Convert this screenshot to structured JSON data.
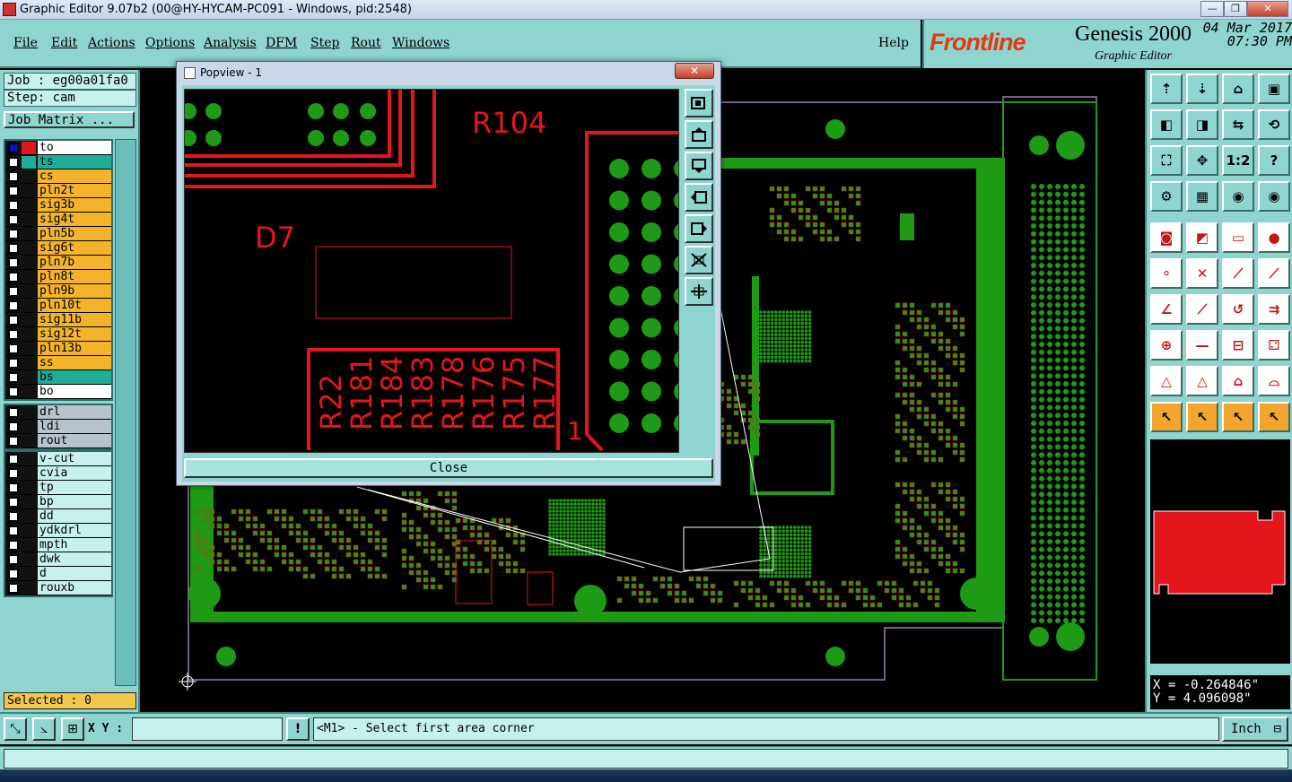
{
  "window": {
    "title": "Graphic Editor 9.07b2 (00@HY-HYCAM-PC091 - Windows, pid:2548)",
    "min": "—",
    "max": "❐",
    "close": "✕"
  },
  "menu": [
    "File",
    "Edit",
    "Actions",
    "Options",
    "Analysis",
    "DFM",
    "Step",
    "Rout",
    "Windows"
  ],
  "help": "Help",
  "brand": {
    "logo": "Frontline",
    "product": "Genesis 2000",
    "subtitle": "Graphic Editor",
    "date": "04 Mar 2017",
    "time": "07:30 PM"
  },
  "job": "Job : eg00a01fa0",
  "step": "Step: cam",
  "job_matrix": "Job Matrix ...",
  "layers_board": [
    {
      "name": "to",
      "color": "#ffffff"
    },
    {
      "name": "ts",
      "color": "#1eae98"
    },
    {
      "name": "cs",
      "color": "#f3b42c"
    },
    {
      "name": "pln2t",
      "color": "#f3b42c"
    },
    {
      "name": "sig3b",
      "color": "#f3b42c"
    },
    {
      "name": "sig4t",
      "color": "#f3b42c"
    },
    {
      "name": "pln5b",
      "color": "#f3b42c"
    },
    {
      "name": "sig6t",
      "color": "#f3b42c"
    },
    {
      "name": "pln7b",
      "color": "#f3b42c"
    },
    {
      "name": "pln8t",
      "color": "#f3b42c"
    },
    {
      "name": "pln9b",
      "color": "#f3b42c"
    },
    {
      "name": "pln10t",
      "color": "#f3b42c"
    },
    {
      "name": "sig11b",
      "color": "#f3b42c"
    },
    {
      "name": "sig12t",
      "color": "#f3b42c"
    },
    {
      "name": "pln13b",
      "color": "#f3b42c"
    },
    {
      "name": "ss",
      "color": "#f3b42c"
    },
    {
      "name": "bs",
      "color": "#1eae98"
    },
    {
      "name": "bo",
      "color": "#ffffff"
    }
  ],
  "layers_drill": [
    {
      "name": "drl",
      "color": "#b9c3cc"
    },
    {
      "name": "ldi",
      "color": "#b9c3cc"
    },
    {
      "name": "rout",
      "color": "#b9c3cc"
    }
  ],
  "layers_misc": [
    {
      "name": "v-cut",
      "color": "#c6f1ec"
    },
    {
      "name": "cvia",
      "color": "#c6f1ec"
    },
    {
      "name": "tp",
      "color": "#c6f1ec"
    },
    {
      "name": "bp",
      "color": "#c6f1ec"
    },
    {
      "name": "dd",
      "color": "#c6f1ec"
    },
    {
      "name": "ydkdrl",
      "color": "#c6f1ec"
    },
    {
      "name": "mpth",
      "color": "#c6f1ec"
    },
    {
      "name": "dwk",
      "color": "#c6f1ec"
    },
    {
      "name": "d",
      "color": "#c6f1ec"
    },
    {
      "name": "rouxb",
      "color": "#c6f1ec"
    }
  ],
  "selected": "Selected : 0",
  "popview": {
    "title": "Popview - 1",
    "close_button": "Close",
    "labels": {
      "r104": "R104",
      "d7": "D7",
      "one": "1"
    },
    "vertical_labels": [
      "R22",
      "R181",
      "R184",
      "R183",
      "R178",
      "R176",
      "R175",
      "R177"
    ]
  },
  "coords": {
    "x": "X = -0.264846\"",
    "y": "Y = 4.096098\""
  },
  "bottom": {
    "xy_label": "X Y :",
    "xy_value": "",
    "prompt": "<M1> - Select first area corner",
    "unit": "Inch",
    "alert": "!"
  },
  "colors": {
    "panel": "#8fd5cf",
    "copper": "#1e9b14",
    "feature": "#e4161b"
  }
}
